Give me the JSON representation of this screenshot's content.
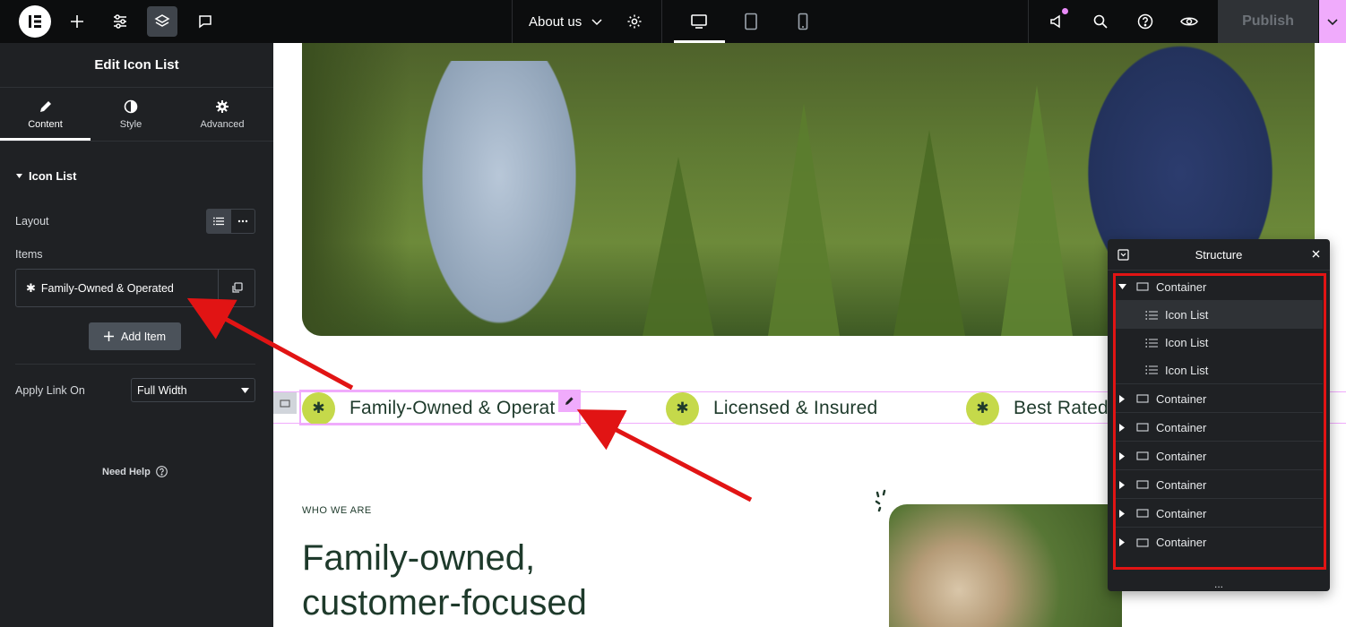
{
  "topbar": {
    "page_name": "About us",
    "publish_label": "Publish",
    "colors": {
      "bg": "#0c0d0e",
      "accent": "#f0abfc"
    }
  },
  "panel": {
    "title": "Edit Icon List",
    "tabs": [
      {
        "label": "Content",
        "icon": "pencil-icon",
        "active": true
      },
      {
        "label": "Style",
        "icon": "half-circle-icon",
        "active": false
      },
      {
        "label": "Advanced",
        "icon": "gear-icon",
        "active": false
      }
    ],
    "section_title": "Icon List",
    "layout_label": "Layout",
    "items_label": "Items",
    "item_text": "Family-Owned & Operated",
    "add_item_label": "Add Item",
    "apply_link_label": "Apply Link On",
    "apply_link_value": "Full Width",
    "need_help_label": "Need Help"
  },
  "canvas": {
    "features": [
      {
        "icon": "asterisk-icon",
        "text": "Family-Owned & Operat"
      },
      {
        "icon": "asterisk-icon",
        "text": "Licensed & Insured"
      },
      {
        "icon": "asterisk-icon",
        "text": "Best Rated"
      }
    ],
    "eyebrow": "WHO WE ARE",
    "heading_line1": "Family-owned,",
    "heading_line2": "customer-focused",
    "colors": {
      "text": "#1e3a2b",
      "icon_bg": "#c5d94a"
    }
  },
  "structure": {
    "title": "Structure",
    "rows": [
      {
        "label": "Container",
        "expanded": true
      },
      {
        "label": "Icon List",
        "child": true,
        "selected": true
      },
      {
        "label": "Icon List",
        "child": true
      },
      {
        "label": "Icon List",
        "child": true
      },
      {
        "label": "Container"
      },
      {
        "label": "Container"
      },
      {
        "label": "Container"
      },
      {
        "label": "Container"
      },
      {
        "label": "Container"
      },
      {
        "label": "Container"
      }
    ],
    "footer": "..."
  }
}
